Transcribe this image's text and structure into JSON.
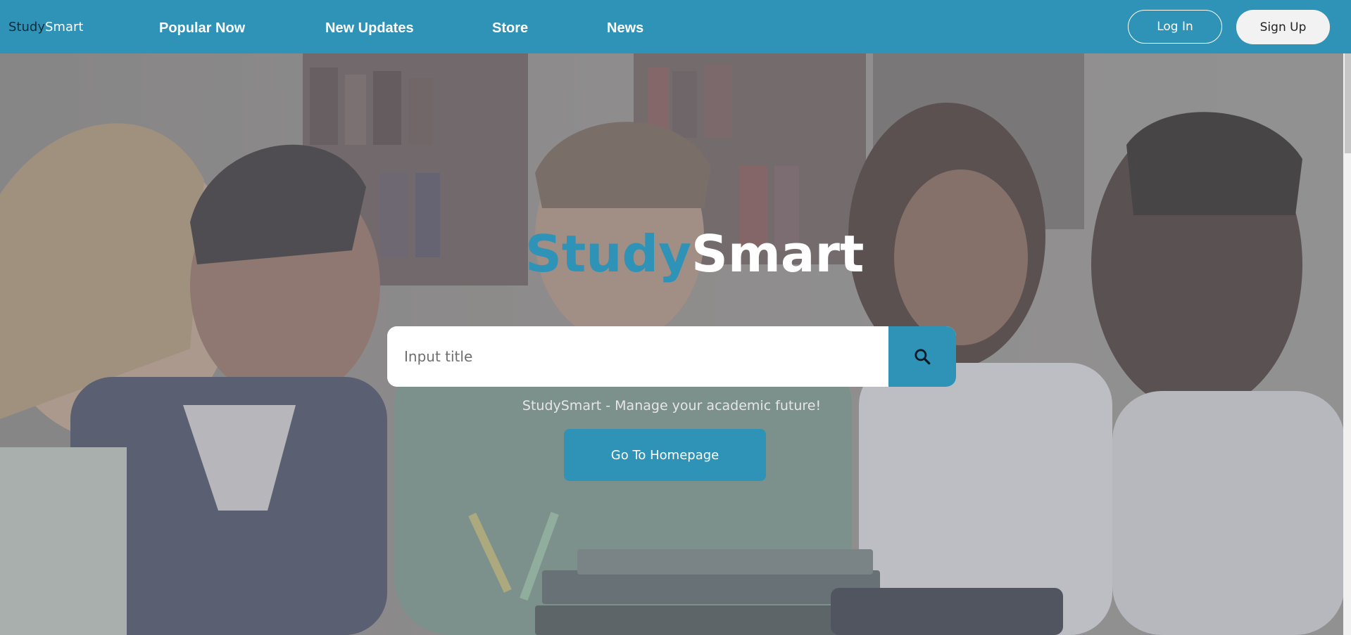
{
  "brand": {
    "first": "Study",
    "second": "Smart"
  },
  "nav": {
    "links": [
      {
        "label": "Popular Now"
      },
      {
        "label": "New Updates"
      },
      {
        "label": "Store"
      },
      {
        "label": "News"
      }
    ],
    "login_label": "Log In",
    "signup_label": "Sign Up"
  },
  "hero": {
    "title_first": "Study",
    "title_second": "Smart",
    "search_placeholder": "Input title",
    "search_icon": "search-icon",
    "tagline": "StudySmart - Manage your academic future!",
    "cta_label": "Go To Homepage"
  },
  "colors": {
    "primary": "#2e93b6",
    "navbar_bg": "#2e93b6",
    "brand_dark": "#0d2b3a",
    "white": "#ffffff",
    "signup_bg": "#f2f2f2"
  }
}
